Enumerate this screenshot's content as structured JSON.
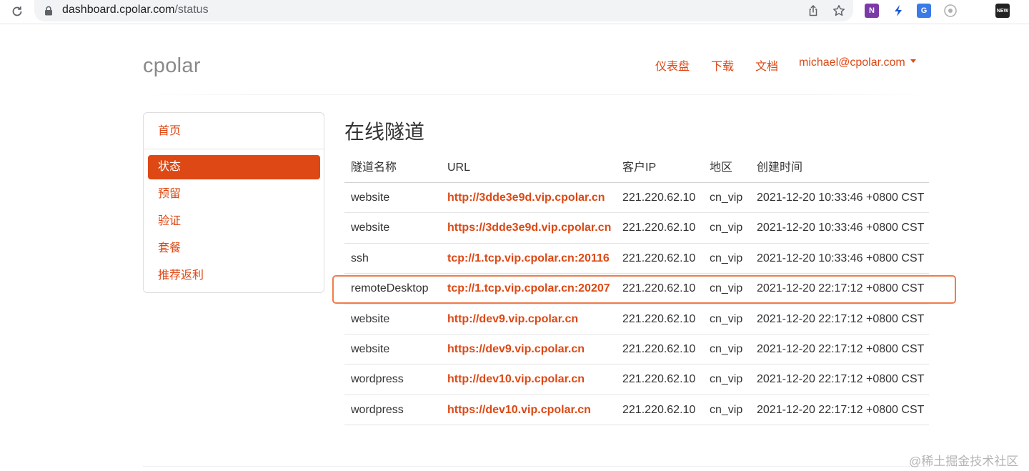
{
  "browser": {
    "url_host": "dashboard.cpolar.com",
    "url_path": "/status",
    "extensions": [
      {
        "name": "onenote-icon",
        "color": "#7b3aa8",
        "label": "N"
      },
      {
        "name": "bolt-icon",
        "color": "#1a56d6",
        "label": ""
      },
      {
        "name": "translate-icon",
        "color": "#3b7be8",
        "label": "G"
      },
      {
        "name": "extension-icon",
        "color": "#b0b0b0",
        "label": ""
      },
      {
        "name": "news-icon",
        "color": "#222222",
        "label": "NEW"
      }
    ]
  },
  "header": {
    "brand": "cpolar",
    "nav": {
      "dashboard": "仪表盘",
      "download": "下载",
      "docs": "文档",
      "account": "michael@cpolar.com"
    }
  },
  "sidebar": {
    "items": [
      {
        "label": "首页",
        "active": false
      },
      {
        "label": "状态",
        "active": true
      },
      {
        "label": "预留",
        "active": false
      },
      {
        "label": "验证",
        "active": false
      },
      {
        "label": "套餐",
        "active": false
      },
      {
        "label": "推荐返利",
        "active": false
      }
    ]
  },
  "main": {
    "title": "在线隧道",
    "columns": [
      "隧道名称",
      "URL",
      "客户IP",
      "地区",
      "创建时间"
    ],
    "rows": [
      {
        "name": "website",
        "url": "http://3dde3e9d.vip.cpolar.cn",
        "ip": "221.220.62.10",
        "region": "cn_vip",
        "created": "2021-12-20 10:33:46 +0800 CST"
      },
      {
        "name": "website",
        "url": "https://3dde3e9d.vip.cpolar.cn",
        "ip": "221.220.62.10",
        "region": "cn_vip",
        "created": "2021-12-20 10:33:46 +0800 CST"
      },
      {
        "name": "ssh",
        "url": "tcp://1.tcp.vip.cpolar.cn:20116",
        "ip": "221.220.62.10",
        "region": "cn_vip",
        "created": "2021-12-20 10:33:46 +0800 CST"
      },
      {
        "name": "remoteDesktop",
        "url": "tcp://1.tcp.vip.cpolar.cn:20207",
        "ip": "221.220.62.10",
        "region": "cn_vip",
        "created": "2021-12-20 22:17:12 +0800 CST"
      },
      {
        "name": "website",
        "url": "http://dev9.vip.cpolar.cn",
        "ip": "221.220.62.10",
        "region": "cn_vip",
        "created": "2021-12-20 22:17:12 +0800 CST"
      },
      {
        "name": "website",
        "url": "https://dev9.vip.cpolar.cn",
        "ip": "221.220.62.10",
        "region": "cn_vip",
        "created": "2021-12-20 22:17:12 +0800 CST"
      },
      {
        "name": "wordpress",
        "url": "http://dev10.vip.cpolar.cn",
        "ip": "221.220.62.10",
        "region": "cn_vip",
        "created": "2021-12-20 22:17:12 +0800 CST"
      },
      {
        "name": "wordpress",
        "url": "https://dev10.vip.cpolar.cn",
        "ip": "221.220.62.10",
        "region": "cn_vip",
        "created": "2021-12-20 22:17:12 +0800 CST"
      }
    ]
  },
  "watermark": "@稀土掘金技术社区",
  "colors": {
    "accent": "#dd4814",
    "highlight": "#f07c4a"
  }
}
